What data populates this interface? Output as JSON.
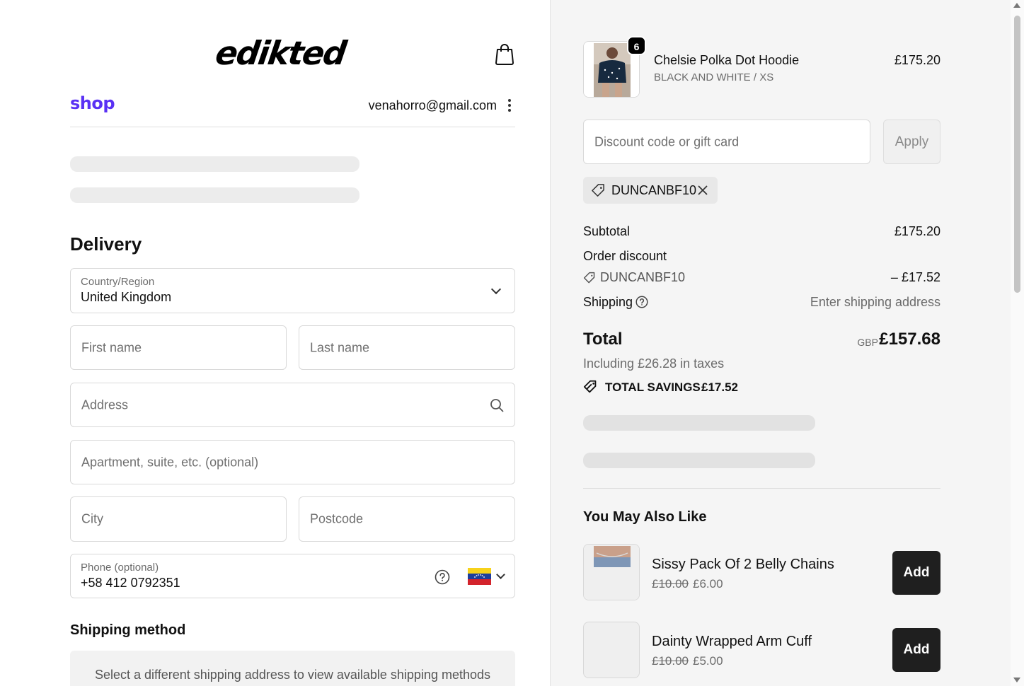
{
  "store": {
    "logo_text": "edikted"
  },
  "shop": {
    "logo": "shop",
    "email": "venahorro@gmail.com"
  },
  "delivery": {
    "heading": "Delivery",
    "country_label": "Country/Region",
    "country_value": "United Kingdom",
    "first_name_placeholder": "First name",
    "last_name_placeholder": "Last name",
    "address_placeholder": "Address",
    "apartment_placeholder": "Apartment, suite, etc. (optional)",
    "city_placeholder": "City",
    "postcode_placeholder": "Postcode",
    "phone_label": "Phone (optional)",
    "phone_value": "+58 412 0792351"
  },
  "shipping_method": {
    "heading": "Shipping method",
    "message": "Select a different shipping address to view available shipping methods"
  },
  "cart": {
    "item": {
      "name": "Chelsie Polka Dot Hoodie",
      "variant": "BLACK AND WHITE / XS",
      "price": "£175.20",
      "quantity": "6"
    },
    "discount_placeholder": "Discount code or gift card",
    "apply_label": "Apply",
    "applied_code": "DUNCANBF10"
  },
  "summary": {
    "subtotal_label": "Subtotal",
    "subtotal_value": "£175.20",
    "order_discount_label": "Order discount",
    "discount_code": "DUNCANBF10",
    "discount_value": "– £17.52",
    "shipping_label": "Shipping",
    "shipping_value": "Enter shipping address",
    "total_label": "Total",
    "currency": "GBP",
    "total_value": "£157.68",
    "taxes_note": "Including £26.28 in taxes",
    "savings_label": "TOTAL SAVINGS",
    "savings_value": "£17.52"
  },
  "upsell": {
    "heading": "You May Also Like",
    "items": [
      {
        "name": "Sissy Pack Of 2 Belly Chains",
        "old_price": "£10.00",
        "price": "£6.00",
        "button": "Add"
      },
      {
        "name": "Dainty Wrapped Arm Cuff",
        "old_price": "£10.00",
        "price": "£5.00",
        "button": "Add"
      }
    ]
  },
  "colors": {
    "shop_brand": "#5a31f4",
    "add_button": "#1f1f1f",
    "panel_bg": "#f5f5f5"
  },
  "icons": [
    "shopping-bag-icon",
    "kebab-menu-icon",
    "chevron-down-icon",
    "search-icon",
    "help-circle-icon",
    "venezuela-flag-icon",
    "tag-icon",
    "close-icon",
    "savings-tag-icon"
  ]
}
